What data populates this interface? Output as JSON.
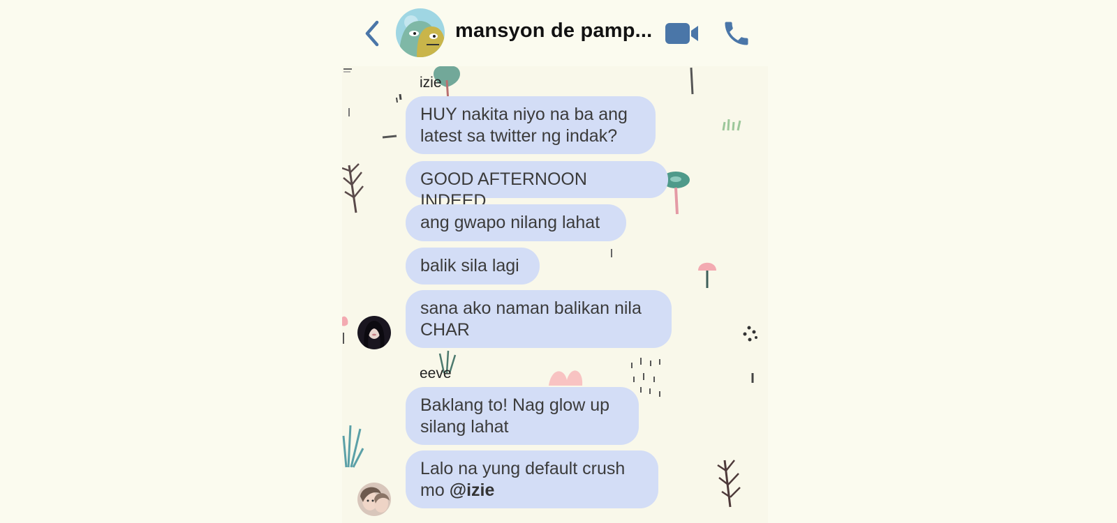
{
  "header": {
    "title": "mansyon de pamp...",
    "back_icon": "chevron-left-icon",
    "video_icon": "video-camera-icon",
    "call_icon": "phone-icon",
    "accent_color": "#4a76a8"
  },
  "messages": {
    "izie": {
      "sender": "izie",
      "m1": "HUY nakita niyo na ba ang latest sa twitter ng indak?",
      "m2": "GOOD AFTERNOON INDEED",
      "m3": "ang gwapo nilang lahat",
      "m4": "balik sila lagi",
      "m5": "sana ako naman balikan nila CHAR"
    },
    "eeve": {
      "sender": "eeve",
      "m1": "Baklang to! Nag glow up silang lahat",
      "m2_text": "Lalo na yung default crush mo ",
      "m2_mention": "@izie"
    }
  },
  "bubble_color": "#d3ddf6"
}
